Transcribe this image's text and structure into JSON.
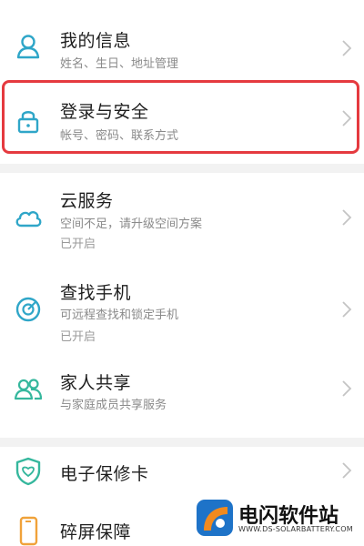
{
  "colors": {
    "accent": "#2fa6c8",
    "highlight": "#e53a3f",
    "subtext": "#8a8a8a",
    "divider": "#f2f2f2"
  },
  "items": [
    {
      "icon": "person-icon",
      "title": "我的信息",
      "subtitle": "姓名、生日、地址管理"
    },
    {
      "icon": "lock-icon",
      "title": "登录与安全",
      "subtitle": "帐号、密码、联系方式"
    },
    {
      "icon": "cloud-icon",
      "title": "云服务",
      "subtitle": "空间不足，请升级空间方案",
      "status": "已开启"
    },
    {
      "icon": "radar-icon",
      "title": "查找手机",
      "subtitle": "可远程查找和锁定手机",
      "status": "已开启"
    },
    {
      "icon": "family-icon",
      "title": "家人共享",
      "subtitle": "与家庭成员共享服务"
    },
    {
      "icon": "shield-heart-icon",
      "title": "电子保修卡"
    },
    {
      "icon": "phone-icon",
      "title": "碎屏保障"
    }
  ],
  "watermark": {
    "title": "电闪软件站",
    "url": "WWW.DS-SOLARBATTERY.COM"
  }
}
